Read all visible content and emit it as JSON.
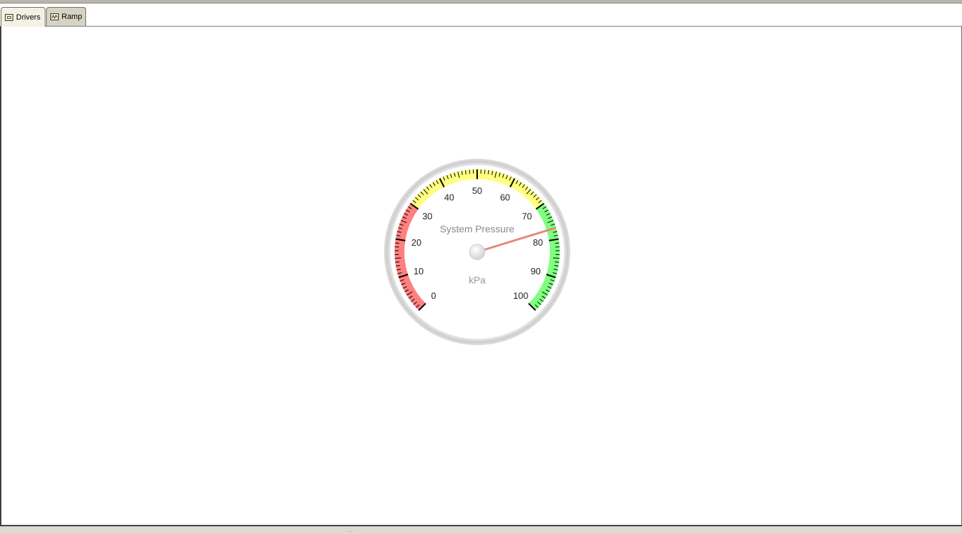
{
  "tabs": [
    {
      "label": "Drivers",
      "icon": "drivers-icon",
      "active": true
    },
    {
      "label": "Ramp",
      "icon": "ramp-icon",
      "active": false
    }
  ],
  "gauge": {
    "title": "System Pressure",
    "unit": "kPa",
    "min": 0,
    "max": 100,
    "value": 77,
    "major_labels": [
      "0",
      "10",
      "20",
      "30",
      "40",
      "50",
      "60",
      "70",
      "80",
      "90",
      "100"
    ],
    "bands": [
      {
        "from": 0,
        "to": 30,
        "color": "#ff8080"
      },
      {
        "from": 30,
        "to": 70,
        "color": "#ffff80"
      },
      {
        "from": 70,
        "to": 100,
        "color": "#80ff80"
      }
    ],
    "needle_color": "#e8877a"
  },
  "status": {
    "grip": "..."
  }
}
